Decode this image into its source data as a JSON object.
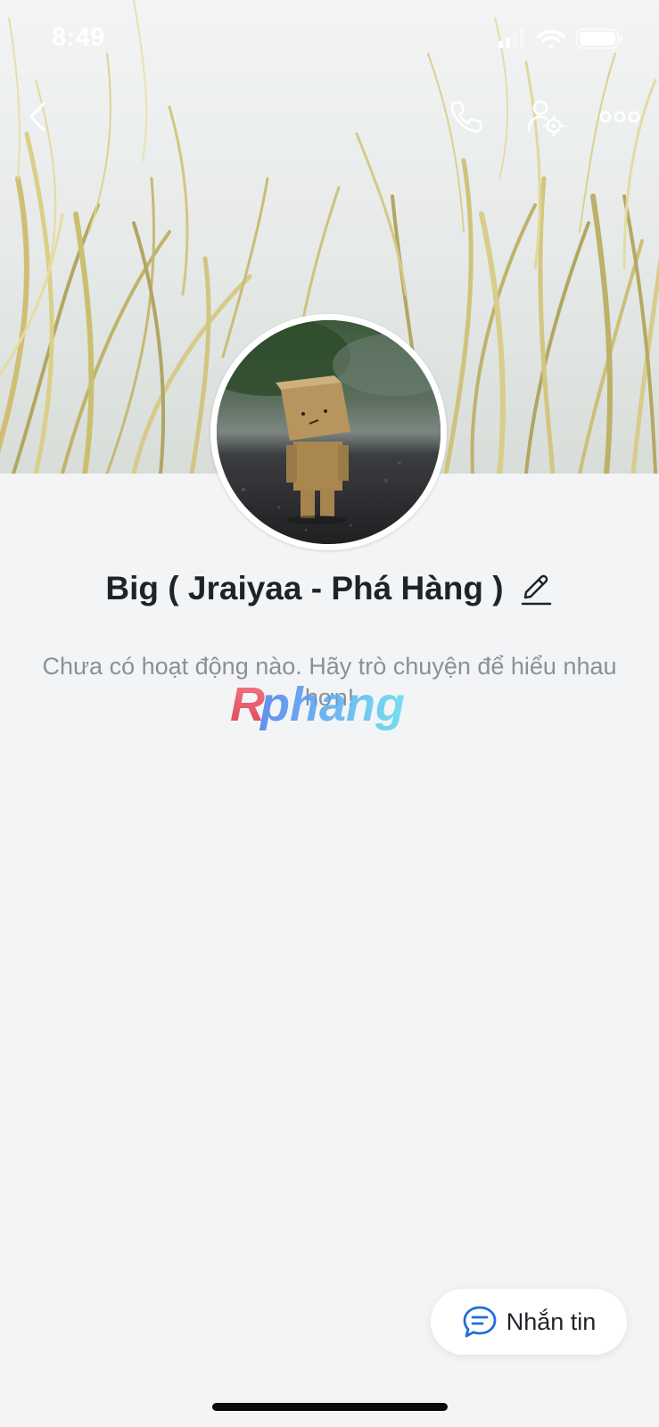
{
  "status_bar": {
    "time": "8:49",
    "signal_icon": "signal-icon",
    "wifi_icon": "wifi-icon",
    "battery_icon": "battery-icon"
  },
  "header": {
    "back_icon": "chevron-left-icon",
    "call_icon": "phone-icon",
    "user_settings_icon": "user-settings-icon",
    "more_icon": "more-dots-icon"
  },
  "profile": {
    "name": "Big ( Jraiyaa - Phá Hàng )",
    "edit_icon": "pencil-icon",
    "empty_activity": "Chưa có hoạt động nào. Hãy trò chuyện để hiểu nhau hơn!"
  },
  "watermark": {
    "text": "Rphang"
  },
  "actions": {
    "message_label": "Nhắn tin",
    "message_icon": "chat-bubble-icon",
    "accent_color": "#1e6fd9"
  }
}
